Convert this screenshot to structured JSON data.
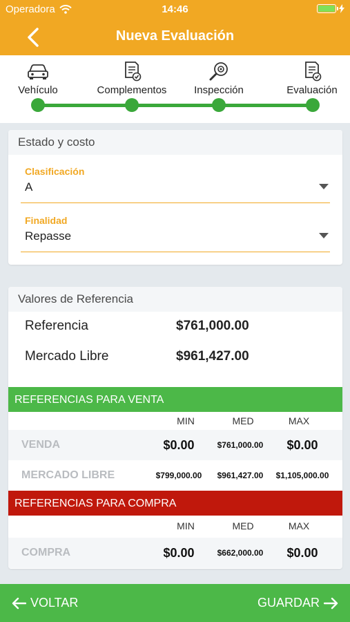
{
  "status": {
    "carrier": "Operadora",
    "time": "14:46"
  },
  "nav": {
    "title": "Nueva Evaluación"
  },
  "steps": [
    {
      "label": "Vehículo",
      "icon": "car-icon"
    },
    {
      "label": "Complementos",
      "icon": "document-check-icon"
    },
    {
      "label": "Inspección",
      "icon": "magnifier-icon"
    },
    {
      "label": "Evaluación",
      "icon": "document-check-icon"
    }
  ],
  "estado": {
    "header": "Estado y costo",
    "clasificacion": {
      "label": "Clasificación",
      "value": "A"
    },
    "finalidad": {
      "label": "Finalidad",
      "value": "Repasse"
    }
  },
  "valores": {
    "header": "Valores de Referencia",
    "referencia": {
      "label": "Referencia",
      "value": "$761,000.00"
    },
    "mercado_libre": {
      "label": "Mercado Libre",
      "value": "$961,427.00"
    },
    "venta": {
      "title": "REFERENCIAS PARA VENTA",
      "columns": [
        "MIN",
        "MED",
        "MAX"
      ],
      "rows": [
        {
          "label": "VENDA",
          "min": "$0.00",
          "med": "$761,000.00",
          "max": "$0.00"
        },
        {
          "label": "MERCADO LIBRE",
          "min": "$799,000.00",
          "med": "$961,427.00",
          "max": "$1,105,000.00"
        }
      ]
    },
    "compra": {
      "title": "REFERENCIAS PARA COMPRA",
      "columns": [
        "MIN",
        "MED",
        "MAX"
      ],
      "rows": [
        {
          "label": "COMPRA",
          "min": "$0.00",
          "med": "$662,000.00",
          "max": "$0.00"
        }
      ]
    }
  },
  "footer": {
    "back_label": "VOLTAR",
    "save_label": "GUARDAR"
  },
  "colors": {
    "accent": "#f1a823",
    "green": "#4cb848",
    "red": "#c0180c",
    "step_green": "#3aa83a"
  }
}
